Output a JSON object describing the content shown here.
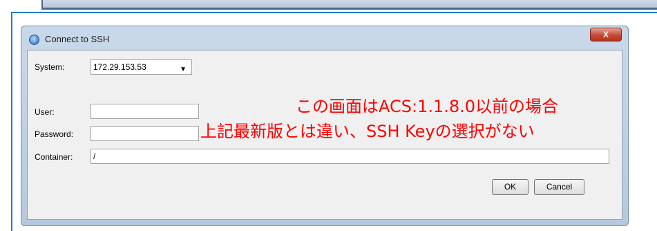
{
  "dialog": {
    "title": "Connect to SSH",
    "close_label": "X",
    "app_icon_glyph": "i"
  },
  "form": {
    "system_label": "System:",
    "system_value": "172.29.153.53",
    "user_label": "User:",
    "user_value": "",
    "password_label": "Password:",
    "password_value": "",
    "container_label": "Container:",
    "container_value": "/"
  },
  "buttons": {
    "ok_label": "OK",
    "cancel_label": "Cancel"
  },
  "annotation": {
    "line1": "この画面はACS:1.1.8.0以前の場合",
    "line2": "上記最新版とは違い、SSH Keyの選択がない",
    "color": "#ff0000"
  }
}
